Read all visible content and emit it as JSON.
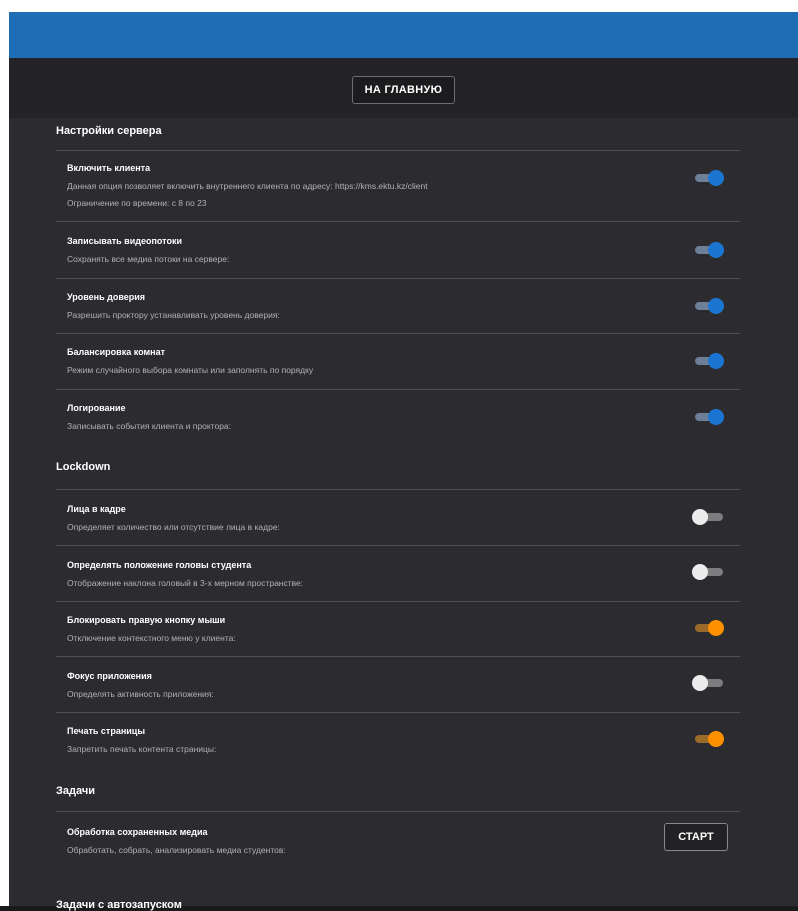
{
  "nav": {
    "home_button": "НА ГЛАВНУЮ"
  },
  "colors": {
    "header": "#1f6db4",
    "toggle_blue": "#1a76d2",
    "toggle_orange": "#ff9100"
  },
  "sections": {
    "server": {
      "title": "Настройки сервера",
      "items": [
        {
          "title": "Включить клиента",
          "desc": "Данная опция позволяет включить внутреннего клиента по адресу: https://kms.ektu.kz/client",
          "desc2": "Ограничение по времени: с 8 по 23",
          "state": "on"
        },
        {
          "title": "Записывать видеопотоки",
          "desc": "Сохранять все медиа потоки на сервере:",
          "state": "on"
        },
        {
          "title": "Уровень доверия",
          "desc": "Разрешить проктору устанавливать уровень доверия:",
          "state": "on"
        },
        {
          "title": "Балансировка комнат",
          "desc": "Режим случайного выбора комнаты или заполнять по порядку",
          "state": "on"
        },
        {
          "title": "Логирование",
          "desc": "Записывать события клиента и проктора:",
          "state": "on"
        }
      ]
    },
    "lockdown": {
      "title": "Lockdown",
      "items": [
        {
          "title": "Лица в кадре",
          "desc": "Определяет количество или отсутствие лица в кадре:",
          "state": "off"
        },
        {
          "title": "Определять положение головы студента",
          "desc": "Отображение наклона головый в 3-х мерном пространстве:",
          "state": "off"
        },
        {
          "title": "Блокировать правую кнопку мыши",
          "desc": "Отключение контекстного меню у клиента:",
          "state": "on"
        },
        {
          "title": "Фокус приложения",
          "desc": "Определять активность приложения:",
          "state": "off"
        },
        {
          "title": "Печать страницы",
          "desc": "Запретить печать контента страницы:",
          "state": "on"
        }
      ]
    },
    "tasks": {
      "title": "Задачи",
      "items": [
        {
          "title": "Обработка сохраненных медиа",
          "desc": "Обработать, собрать, анализировать медиа студентов:",
          "button": "СТАРТ"
        }
      ]
    },
    "autorun": {
      "title": "Задачи с автозапуском"
    }
  }
}
